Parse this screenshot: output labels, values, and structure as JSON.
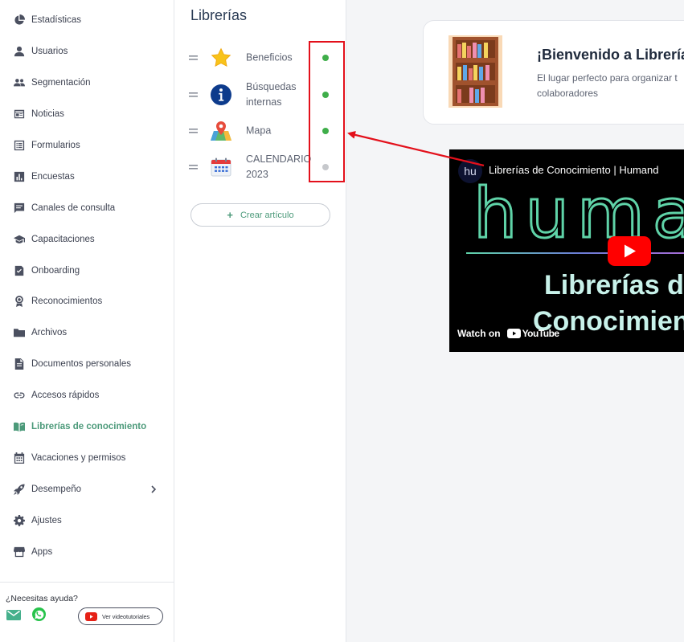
{
  "sidebar": {
    "items": [
      {
        "label": "Estadísticas",
        "icon": "pie-chart-icon"
      },
      {
        "label": "Usuarios",
        "icon": "user-icon"
      },
      {
        "label": "Segmentación",
        "icon": "group-icon"
      },
      {
        "label": "Noticias",
        "icon": "newspaper-icon"
      },
      {
        "label": "Formularios",
        "icon": "form-icon"
      },
      {
        "label": "Encuestas",
        "icon": "bar-chart-icon"
      },
      {
        "label": "Canales de consulta",
        "icon": "chat-icon"
      },
      {
        "label": "Capacitaciones",
        "icon": "graduation-cap-icon"
      },
      {
        "label": "Onboarding",
        "icon": "checklist-icon"
      },
      {
        "label": "Reconocimientos",
        "icon": "award-icon"
      },
      {
        "label": "Archivos",
        "icon": "folder-icon"
      },
      {
        "label": "Documentos personales",
        "icon": "document-icon"
      },
      {
        "label": "Accesos rápidos",
        "icon": "link-icon"
      },
      {
        "label": "Librerías de conocimiento",
        "icon": "book-icon",
        "active": true
      },
      {
        "label": "Vacaciones y permisos",
        "icon": "calendar-icon"
      },
      {
        "label": "Desempeño",
        "icon": "rocket-icon",
        "has_submenu": true
      },
      {
        "label": "Ajustes",
        "icon": "gear-icon"
      },
      {
        "label": "Apps",
        "icon": "store-icon"
      }
    ],
    "help": {
      "title": "¿Necesitas ayuda?",
      "video_button": "Ver videotutoriales"
    }
  },
  "libraries": {
    "title": "Librerías",
    "items": [
      {
        "name": "Beneficios",
        "icon": "star-icon",
        "enabled": true
      },
      {
        "name": "Búsquedas internas",
        "icon": "info-icon",
        "enabled": true
      },
      {
        "name": "Mapa",
        "icon": "map-icon",
        "enabled": true
      },
      {
        "name": "CALENDARIO 2023",
        "icon": "calendar-icon",
        "enabled": false
      }
    ],
    "create_button": "Crear artículo"
  },
  "welcome": {
    "title": "¡Bienvenido a Librería",
    "text_line1": "El lugar perfecto para organizar t",
    "text_line2": "colaboradores"
  },
  "video": {
    "channel_avatar": "hu",
    "title": "Librerías de Conocimiento | Humand",
    "logo_text": "humand",
    "headline1": "Librerías de",
    "headline2": "Conocimiento",
    "watch_on": "Watch on",
    "platform": "YouTube"
  },
  "colors": {
    "accent": "#4c9a7a",
    "enabled_dot": "#3fae4a",
    "disabled_dot": "#c6c8cc",
    "annotation": "#e3101b"
  }
}
